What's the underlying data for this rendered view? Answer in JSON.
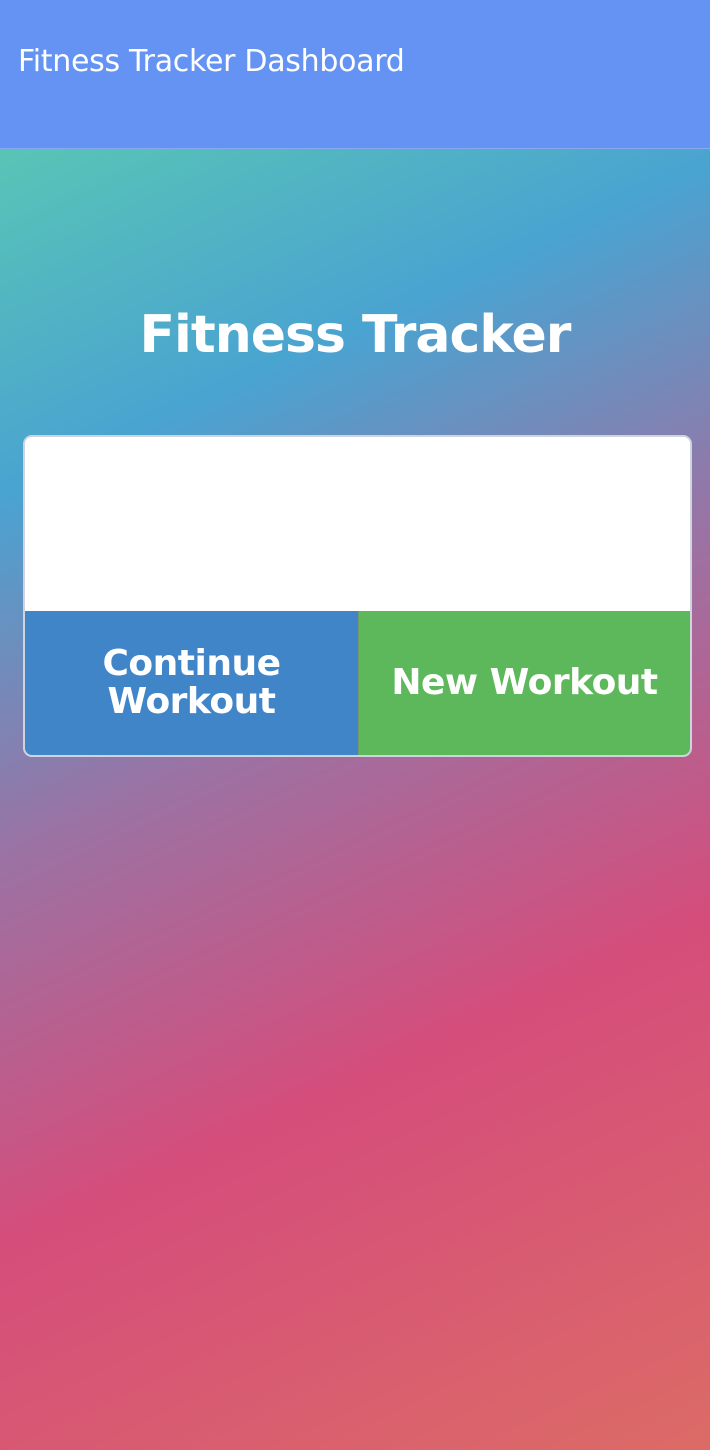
{
  "header": {
    "title": "Fitness Tracker Dashboard",
    "background_color": "#6493f3"
  },
  "main": {
    "title": "Fitness Tracker"
  },
  "card": {
    "continue_button_label": "Continue Workout",
    "new_button_label": "New Workout",
    "continue_color": "#4185c9",
    "new_color": "#5cb85a"
  }
}
